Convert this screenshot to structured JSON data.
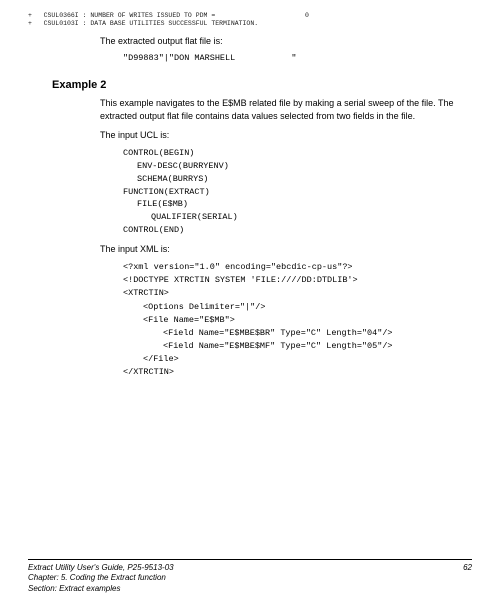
{
  "log": [
    "+   CSUL0366I : NUMBER OF WRITES ISSUED TO PDM =                       0",
    "+   CSUL0103I : DATA BASE UTILITIES SUCCESSFUL TERMINATION."
  ],
  "section1": {
    "intro": "The extracted output flat file is:",
    "output": "\"D99883\"|\"DON MARSHELL           \""
  },
  "example": {
    "heading": "Example 2",
    "desc": "This example navigates to the E$MB related file by making a serial sweep of the file.  The extracted output flat file contains data values selected from two fields in the file.",
    "ucl_intro": "The input UCL is:",
    "ucl": {
      "l0": "CONTROL(BEGIN)",
      "l1": "ENV-DESC(BURRYENV)",
      "l2": "SCHEMA(BURRYS)",
      "l3": "FUNCTION(EXTRACT)",
      "l4": "FILE(E$MB)",
      "l5": "QUALIFIER(SERIAL)",
      "l6": "CONTROL(END)"
    },
    "xml_intro": "The input XML is:",
    "xml": {
      "l0": "<?xml version=\"1.0\" encoding=\"ebcdic-cp-us\"?>",
      "l1": "<!DOCTYPE XTRCTIN SYSTEM 'FILE:////DD:DTDLIB'>",
      "l2": "<XTRCTIN>",
      "l3": "<Options Delimiter=\"|\"/>",
      "l4": "<File Name=\"E$MB\">",
      "l5": "<Field Name=\"E$MBE$BR\" Type=\"C\" Length=\"04\"/>",
      "l6": "<Field Name=\"E$MBE$MF\" Type=\"C\" Length=\"05\"/>",
      "l7": "</File>",
      "l8": "</XTRCTIN>"
    }
  },
  "footer": {
    "guide": "Extract Utility User's Guide, P25-9513-03",
    "chapter": "Chapter: 5. Coding the Extract function",
    "section": "Section: Extract examples",
    "page": "62"
  }
}
